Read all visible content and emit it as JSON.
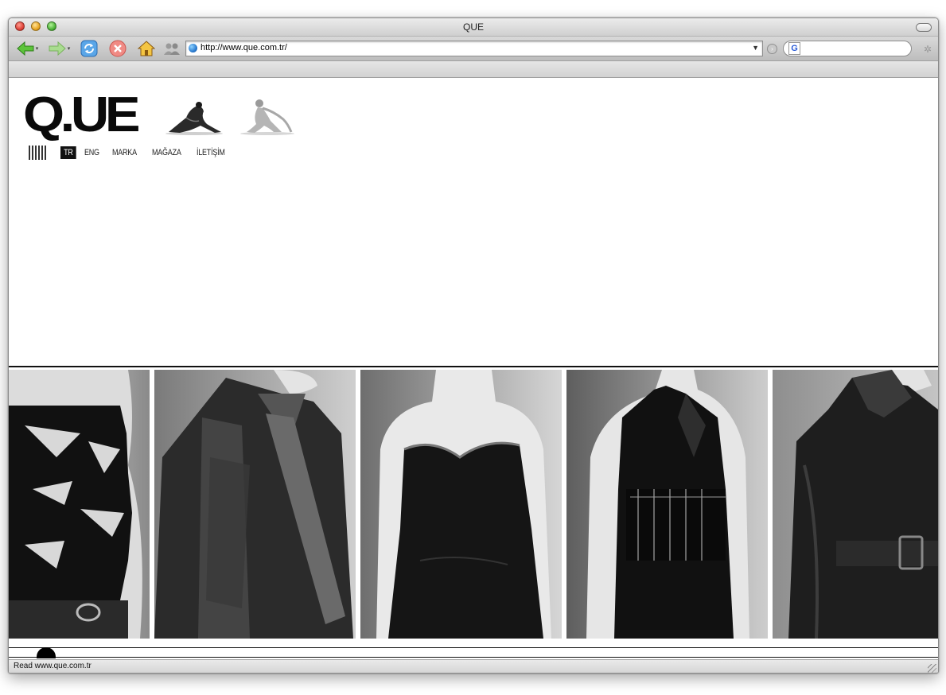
{
  "window": {
    "title": "QUE"
  },
  "toolbar": {
    "url": "http://www.que.com.tr/",
    "search_placeholder": ""
  },
  "site": {
    "logo": "Q.UE",
    "nav": [
      {
        "label": "TR",
        "active": true
      },
      {
        "label": "ENG",
        "active": false
      },
      {
        "label": "MARKA",
        "active": false
      },
      {
        "label": "MAĞAZA",
        "active": false
      },
      {
        "label": "İLETİŞİM",
        "active": false
      }
    ]
  },
  "status": {
    "text": "Read www.que.com.tr"
  },
  "colors": {
    "accent": "#000000",
    "background": "#ffffff"
  }
}
